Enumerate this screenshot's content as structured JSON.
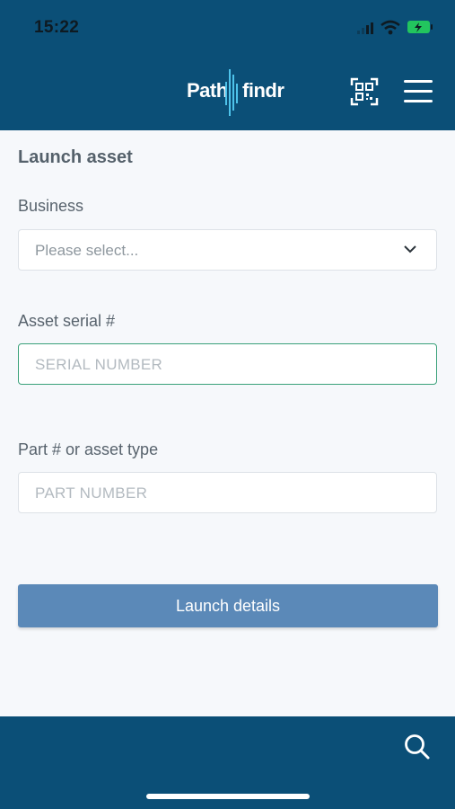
{
  "status_bar": {
    "time": "15:22",
    "icons": [
      "signal-icon",
      "wifi-icon",
      "battery-charging-icon"
    ]
  },
  "header": {
    "logo_left": "Path",
    "logo_right": "findr",
    "icons": [
      "qr-code-icon",
      "hamburger-menu-icon"
    ]
  },
  "form": {
    "title": "Launch asset",
    "business_label": "Business",
    "business_value": "Please select...",
    "serial_label": "Asset serial #",
    "serial_placeholder": "SERIAL NUMBER",
    "part_label": "Part # or asset type",
    "part_placeholder": "PART NUMBER",
    "submit_label": "Launch details"
  },
  "footer": {
    "icons": [
      "search-icon"
    ]
  },
  "colors": {
    "header_bg": "#0b4f77",
    "accent_button": "#5b89b8",
    "focus_border": "#3aa17a",
    "page_bg": "#f6f8fb"
  }
}
